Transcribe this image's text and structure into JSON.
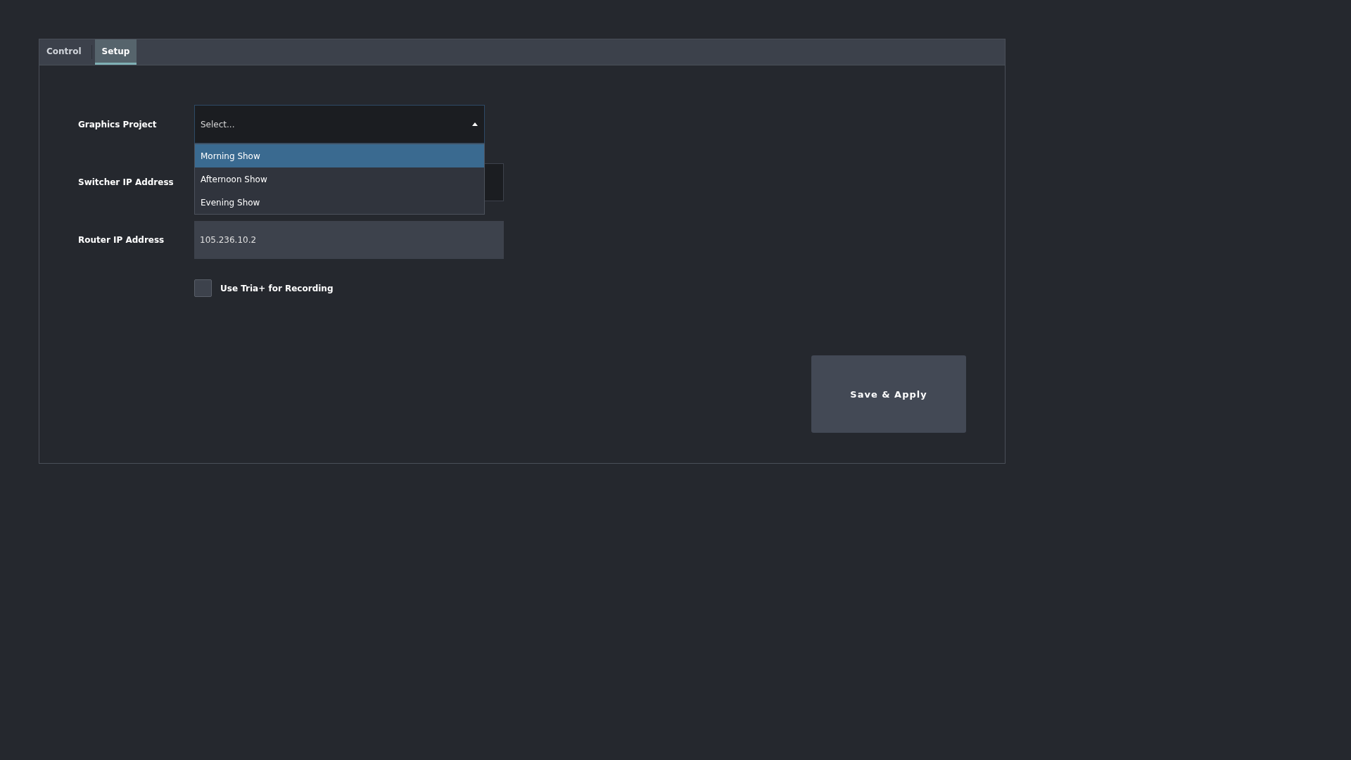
{
  "tabs": [
    {
      "label": "Control",
      "selected": false
    },
    {
      "label": "Setup",
      "selected": true
    }
  ],
  "graphics_project": {
    "label": "Graphics Project",
    "placeholder": "Select...",
    "expanded": true,
    "options": [
      {
        "label": "Morning Show",
        "selected": true
      },
      {
        "label": "Afternoon Show",
        "selected": false
      },
      {
        "label": "Evening Show",
        "selected": false
      }
    ]
  },
  "switcher_ip": {
    "label": "Switcher IP Address"
  },
  "router_ip": {
    "label": "Router IP Address",
    "value": "105.236.10.2"
  },
  "use_tria": {
    "label": "Use Tria+ for Recording",
    "checked": false
  },
  "save_button": "Save & Apply"
}
